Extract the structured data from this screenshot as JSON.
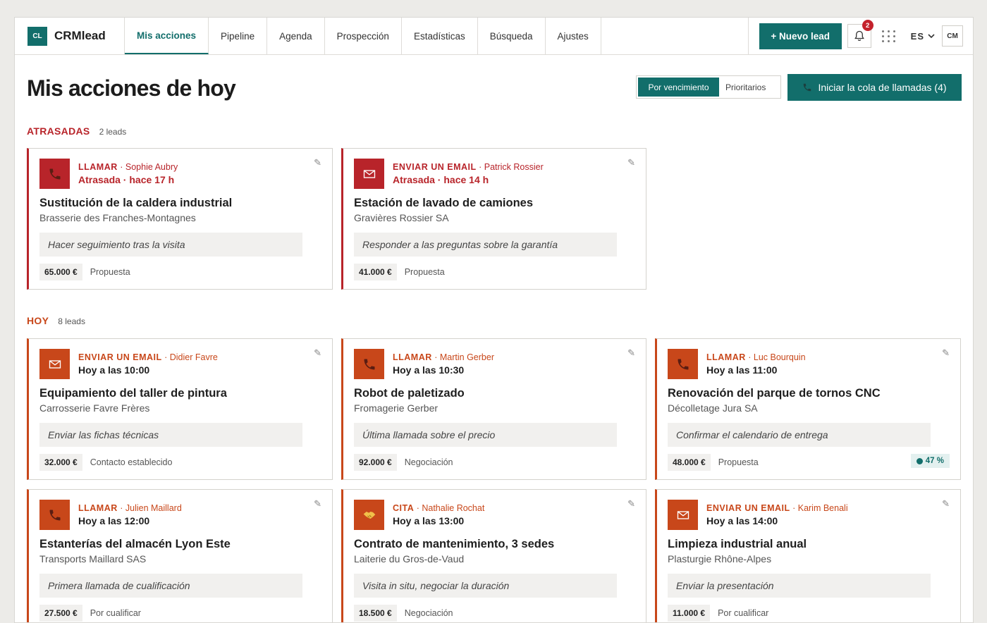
{
  "app": {
    "logo": "CL",
    "name": "CRMlead"
  },
  "nav": {
    "tabs": [
      {
        "label": "Mis acciones",
        "active": true
      },
      {
        "label": "Pipeline",
        "active": false
      },
      {
        "label": "Agenda",
        "active": false
      },
      {
        "label": "Prospección",
        "active": false
      },
      {
        "label": "Estadísticas",
        "active": false
      },
      {
        "label": "Búsqueda",
        "active": false
      },
      {
        "label": "Ajustes",
        "active": false
      }
    ],
    "new_lead": "+  Nuevo lead",
    "notifications": "2",
    "language": "ES",
    "user": "CM"
  },
  "header": {
    "title": "Mis acciones de hoy",
    "sort_due": "Por vencimiento",
    "sort_priority": "Prioritarios",
    "call_queue": "Iniciar la cola de llamadas (4)"
  },
  "colors": {
    "brand": "#126e6b",
    "overdue": "#b8242a",
    "today": "#c8471a"
  },
  "sections": {
    "overdue": {
      "title": "ATRASADAS",
      "count": "2 leads",
      "cards": [
        {
          "icon": "phone-icon",
          "kind": "LLAMAR",
          "contact": " · Sophie Aubry",
          "when": "Atrasada · hace 17 h",
          "deal": "Sustitución de la caldera industrial",
          "company": "Brasserie des Franches-Montagnes",
          "note": "Hacer seguimiento tras la visita",
          "amount": "65.000 €",
          "stage": "Propuesta"
        },
        {
          "icon": "email-icon",
          "kind": "ENVIAR UN EMAIL",
          "contact": " · Patrick Rossier",
          "when": "Atrasada · hace 14 h",
          "deal": "Estación de lavado de camiones",
          "company": "Gravières Rossier SA",
          "note": "Responder a las preguntas sobre la garantía",
          "amount": "41.000 €",
          "stage": "Propuesta"
        }
      ]
    },
    "today": {
      "title": "HOY",
      "count": "8 leads",
      "cards": [
        {
          "icon": "email-icon",
          "kind": "ENVIAR UN EMAIL",
          "contact": " · Didier Favre",
          "when": "Hoy a las 10:00",
          "deal": "Equipamiento del taller de pintura",
          "company": "Carrosserie Favre Frères",
          "note": "Enviar las fichas técnicas",
          "amount": "32.000 €",
          "stage": "Contacto establecido"
        },
        {
          "icon": "phone-icon",
          "kind": "LLAMAR",
          "contact": " · Martin Gerber",
          "when": "Hoy a las 10:30",
          "deal": "Robot de paletizado",
          "company": "Fromagerie Gerber",
          "note": "Última llamada sobre el precio",
          "amount": "92.000 €",
          "stage": "Negociación"
        },
        {
          "icon": "phone-icon",
          "kind": "LLAMAR",
          "contact": " · Luc Bourquin",
          "when": "Hoy a las 11:00",
          "deal": "Renovación del parque de tornos CNC",
          "company": "Décolletage Jura SA",
          "note": "Confirmar el calendario de entrega",
          "amount": "48.000 €",
          "stage": "Propuesta",
          "probability": "47 %"
        },
        {
          "icon": "phone-icon",
          "kind": "LLAMAR",
          "contact": " · Julien Maillard",
          "when": "Hoy a las 12:00",
          "deal": "Estanterías del almacén Lyon Este",
          "company": "Transports Maillard SAS",
          "note": "Primera llamada de cualificación",
          "amount": "27.500 €",
          "stage": "Por cualificar"
        },
        {
          "icon": "handshake-icon",
          "kind": "CITA",
          "contact": " · Nathalie Rochat",
          "when": "Hoy a las 13:00",
          "deal": "Contrato de mantenimiento, 3 sedes",
          "company": "Laiterie du Gros-de-Vaud",
          "note": "Visita in situ, negociar la duración",
          "amount": "18.500 €",
          "stage": "Negociación"
        },
        {
          "icon": "email-icon",
          "kind": "ENVIAR UN EMAIL",
          "contact": " · Karim Benali",
          "when": "Hoy a las 14:00",
          "deal": "Limpieza industrial anual",
          "company": "Plasturgie Rhône-Alpes",
          "note": "Enviar la presentación",
          "amount": "11.000 €",
          "stage": "Por cualificar"
        }
      ]
    }
  }
}
